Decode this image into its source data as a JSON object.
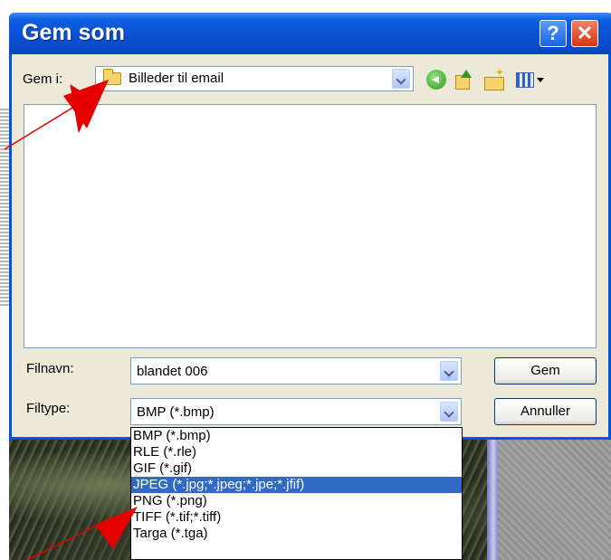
{
  "dialog": {
    "title": "Gem som",
    "help_glyph": "?",
    "close_glyph": "✕"
  },
  "save_in": {
    "label": "Gem i:",
    "value": "Billeder til email"
  },
  "toolbar": {
    "icons": [
      "back-icon",
      "up-folder-icon",
      "new-folder-icon",
      "views-menu-icon"
    ]
  },
  "filename": {
    "label": "Filnavn:",
    "value": "blandet 006"
  },
  "filetype": {
    "label": "Filtype:",
    "value": "BMP (*.bmp)",
    "options": [
      "BMP (*.bmp)",
      "RLE (*.rle)",
      "GIF (*.gif)",
      "JPEG (*.jpg;*.jpeg;*.jpe;*.jfif)",
      "PNG (*.png)",
      "TIFF (*.tif;*.tiff)",
      "Targa (*.tga)"
    ],
    "highlighted_index": 3
  },
  "buttons": {
    "save_label": "Gem",
    "cancel_label": "Annuller"
  },
  "colors": {
    "titlebar": "#0b4fd1",
    "selection": "#316ac5",
    "annotation_arrow": "#e50000"
  }
}
